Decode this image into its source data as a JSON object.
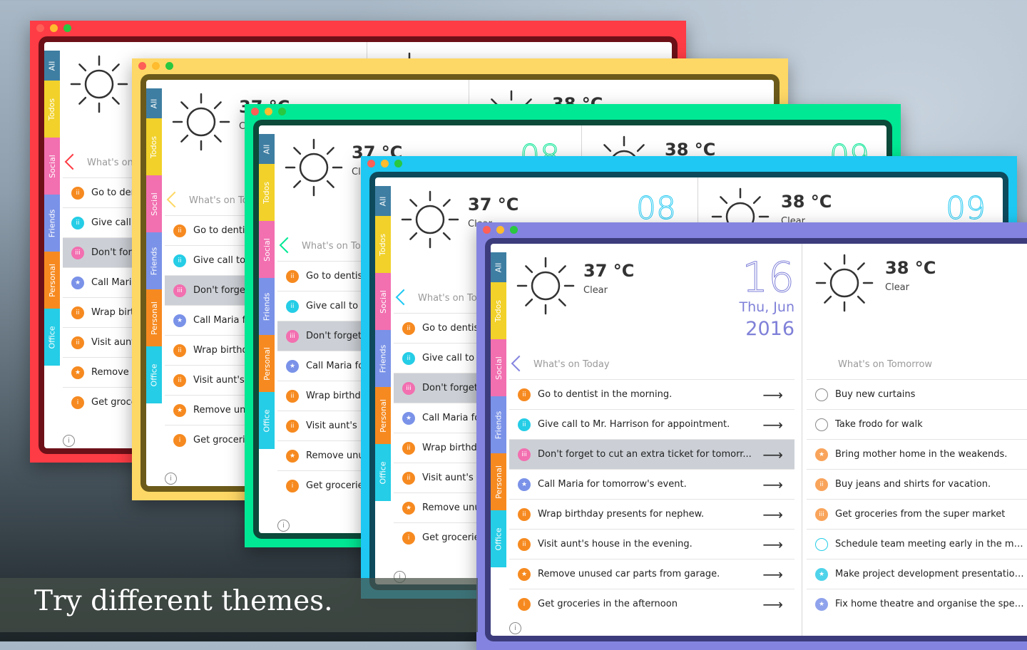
{
  "tagline": "Try different themes.",
  "tab_labels": [
    "All",
    "Todos",
    "Social",
    "Friends",
    "Personal",
    "Office"
  ],
  "weather": {
    "today_temp": "37 °C",
    "today_cond": "Clear",
    "tomorrow_temp": "38 °C",
    "tomorrow_cond": "Clear"
  },
  "date": {
    "day": "16",
    "weekday_month": "Thu, Jun",
    "year": "2016",
    "ghost_today": "08",
    "ghost_tomorrow": "09"
  },
  "today": {
    "title": "What's on Today",
    "items": [
      {
        "icon": "ii",
        "color": "#f68a20",
        "text": "Go to dentist in the morning.",
        "selected": false
      },
      {
        "icon": "ii",
        "color": "#25cde6",
        "text": "Give call to Mr. Harrison for appointment.",
        "selected": false
      },
      {
        "icon": "iii",
        "color": "#f26fb0",
        "text": "Don't forget to cut an extra ticket for tomorr...",
        "selected": true
      },
      {
        "icon": "★",
        "color": "#7a92e8",
        "text": "Call Maria for tomorrow's event.",
        "selected": false
      },
      {
        "icon": "ii",
        "color": "#f68a20",
        "text": "Wrap birthday presents for nephew.",
        "selected": false
      },
      {
        "icon": "ii",
        "color": "#f68a20",
        "text": "Visit aunt's house in the evening.",
        "selected": false
      },
      {
        "icon": "★",
        "color": "#f68a20",
        "text": "Remove unused car parts from garage.",
        "selected": false
      },
      {
        "icon": "i",
        "color": "#f68a20",
        "text": "Get groceries in the afternoon",
        "selected": false
      }
    ]
  },
  "tomorrow": {
    "title": "What's on Tomorrow",
    "items": [
      {
        "icon": "",
        "color": "#888888",
        "outline": true,
        "text": "Buy new curtains"
      },
      {
        "icon": "",
        "color": "#888888",
        "outline": true,
        "text": "Take frodo for walk"
      },
      {
        "icon": "★",
        "color": "#f9a45b",
        "text": "Bring mother home in the weakends."
      },
      {
        "icon": "ii",
        "color": "#f9a45b",
        "text": "Buy jeans and shirts for vacation."
      },
      {
        "icon": "iii",
        "color": "#f9a45b",
        "text": "Get groceries from the super market"
      },
      {
        "icon": "",
        "color": "#25cde6",
        "outline": true,
        "text": "Schedule team meeting early in the morning."
      },
      {
        "icon": "★",
        "color": "#4fd3ea",
        "text": "Make project development presentation for..."
      },
      {
        "icon": "★",
        "color": "#8fa2ec",
        "text": "Fix home theatre and organise the speakers."
      }
    ]
  },
  "themes": [
    {
      "name": "red",
      "bar": "#fe3c45",
      "frame": "#6d1018",
      "accent": "#fe3c45"
    },
    {
      "name": "yellow",
      "bar": "#fed866",
      "frame": "#6b5a1a",
      "accent": "#fed866"
    },
    {
      "name": "green",
      "bar": "#00e894",
      "frame": "#0c4a3a",
      "accent": "#00e894"
    },
    {
      "name": "cyan",
      "bar": "#1ec8f2",
      "frame": "#0d4a5c",
      "accent": "#1ec8f2"
    },
    {
      "name": "purple",
      "bar": "#8484e0",
      "frame": "#3c3c7c",
      "accent": "#8484e0"
    }
  ]
}
